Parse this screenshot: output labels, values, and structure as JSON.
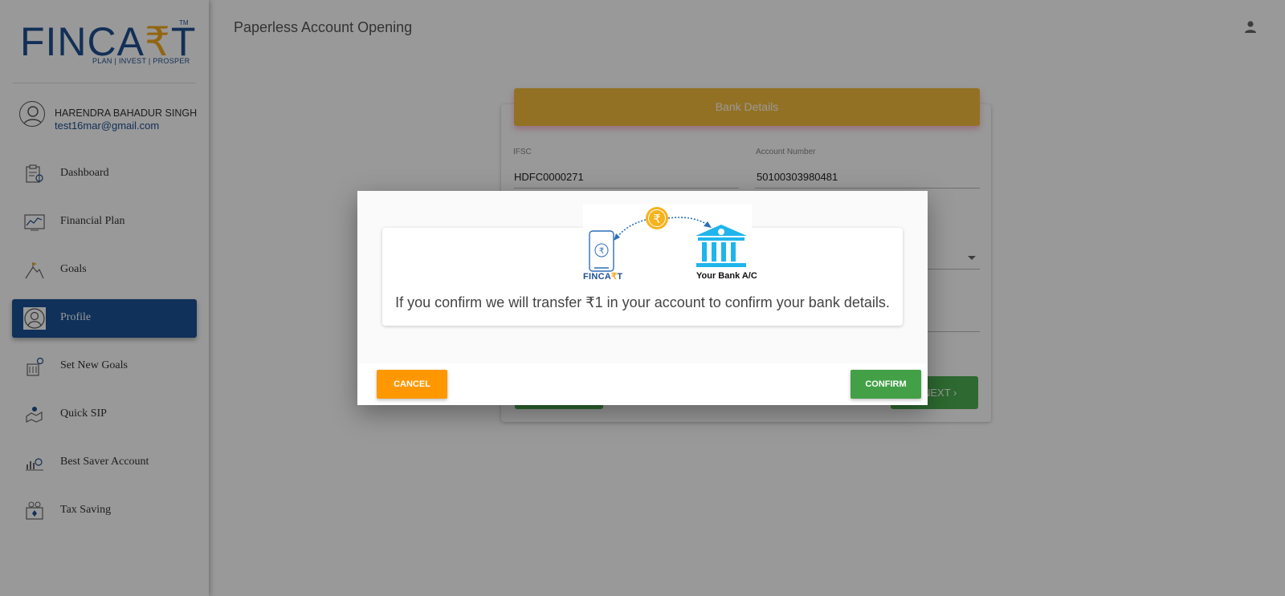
{
  "app": {
    "logo_text_left": "FINCA",
    "logo_text_rupee": "₹",
    "logo_text_right": "T",
    "logo_tm": "TM",
    "logo_tagline": "PLAN | INVEST | PROSPER"
  },
  "user": {
    "name": "HARENDRA BAHADUR SINGH",
    "email": "test16mar@gmail.com"
  },
  "sidebar": {
    "items": [
      {
        "label": "Dashboard",
        "icon": "dashboard-icon",
        "active": false
      },
      {
        "label": "Financial Plan",
        "icon": "chart-icon",
        "active": false
      },
      {
        "label": "Goals",
        "icon": "mountain-flag-icon",
        "active": false
      },
      {
        "label": "Profile",
        "icon": "profile-icon",
        "active": true
      },
      {
        "label": "Set New Goals",
        "icon": "goal-building-icon",
        "active": false
      },
      {
        "label": "Quick SIP",
        "icon": "quick-sip-icon",
        "active": false
      },
      {
        "label": "Best Saver Account",
        "icon": "saver-icon",
        "active": false
      },
      {
        "label": "Tax Saving",
        "icon": "tax-saving-icon",
        "active": false
      }
    ]
  },
  "header": {
    "title": "Paperless Account Opening"
  },
  "form": {
    "section_title": "Bank Details",
    "ifsc_label": "IFSC",
    "ifsc_value": "HDFC0000271",
    "account_label": "Account Number",
    "account_value": "50100303980481",
    "next_label": "NEXT"
  },
  "dialog": {
    "illustration_app_left": "FINCA",
    "illustration_app_rupee": "₹",
    "illustration_app_right": "T",
    "illustration_bank_label": "Your Bank A/C",
    "message": "If you confirm we will transfer ₹1 in your account to confirm your bank details.",
    "cancel_label": "CANCEL",
    "confirm_label": "CONFIRM"
  },
  "colors": {
    "brand_blue": "#1e4f92",
    "brand_orange": "#f3a81d",
    "active_nav": "#1a5296",
    "header_yellow": "#f6bd3c",
    "cancel_orange": "#ff9800",
    "confirm_green": "#43a047"
  }
}
